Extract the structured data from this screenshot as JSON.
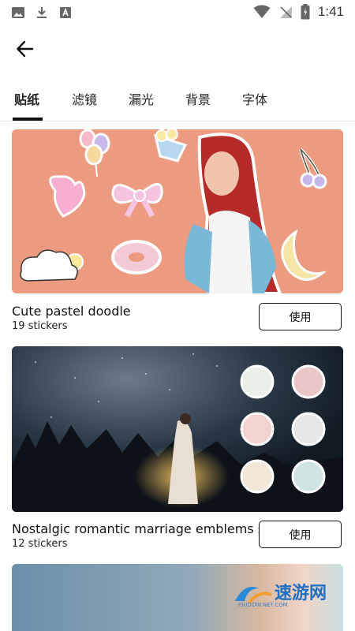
{
  "status": {
    "time": "1:41"
  },
  "tabs": [
    {
      "label": "贴纸"
    },
    {
      "label": "滤镜"
    },
    {
      "label": "漏光"
    },
    {
      "label": "背景"
    },
    {
      "label": "字体"
    }
  ],
  "packs": [
    {
      "title": "Cute pastel doodle",
      "count": "19 stickers",
      "button": "使用"
    },
    {
      "title": "Nostalgic romantic marriage emblems s",
      "count": "12 stickers",
      "button": "使用"
    }
  ],
  "watermark": {
    "brand": "速游网",
    "url": "ISUDOW.NET.COM"
  },
  "colors": {
    "accent": "#111111",
    "card1_bg": "#ec9a80",
    "card2_bg": "#16232e"
  }
}
